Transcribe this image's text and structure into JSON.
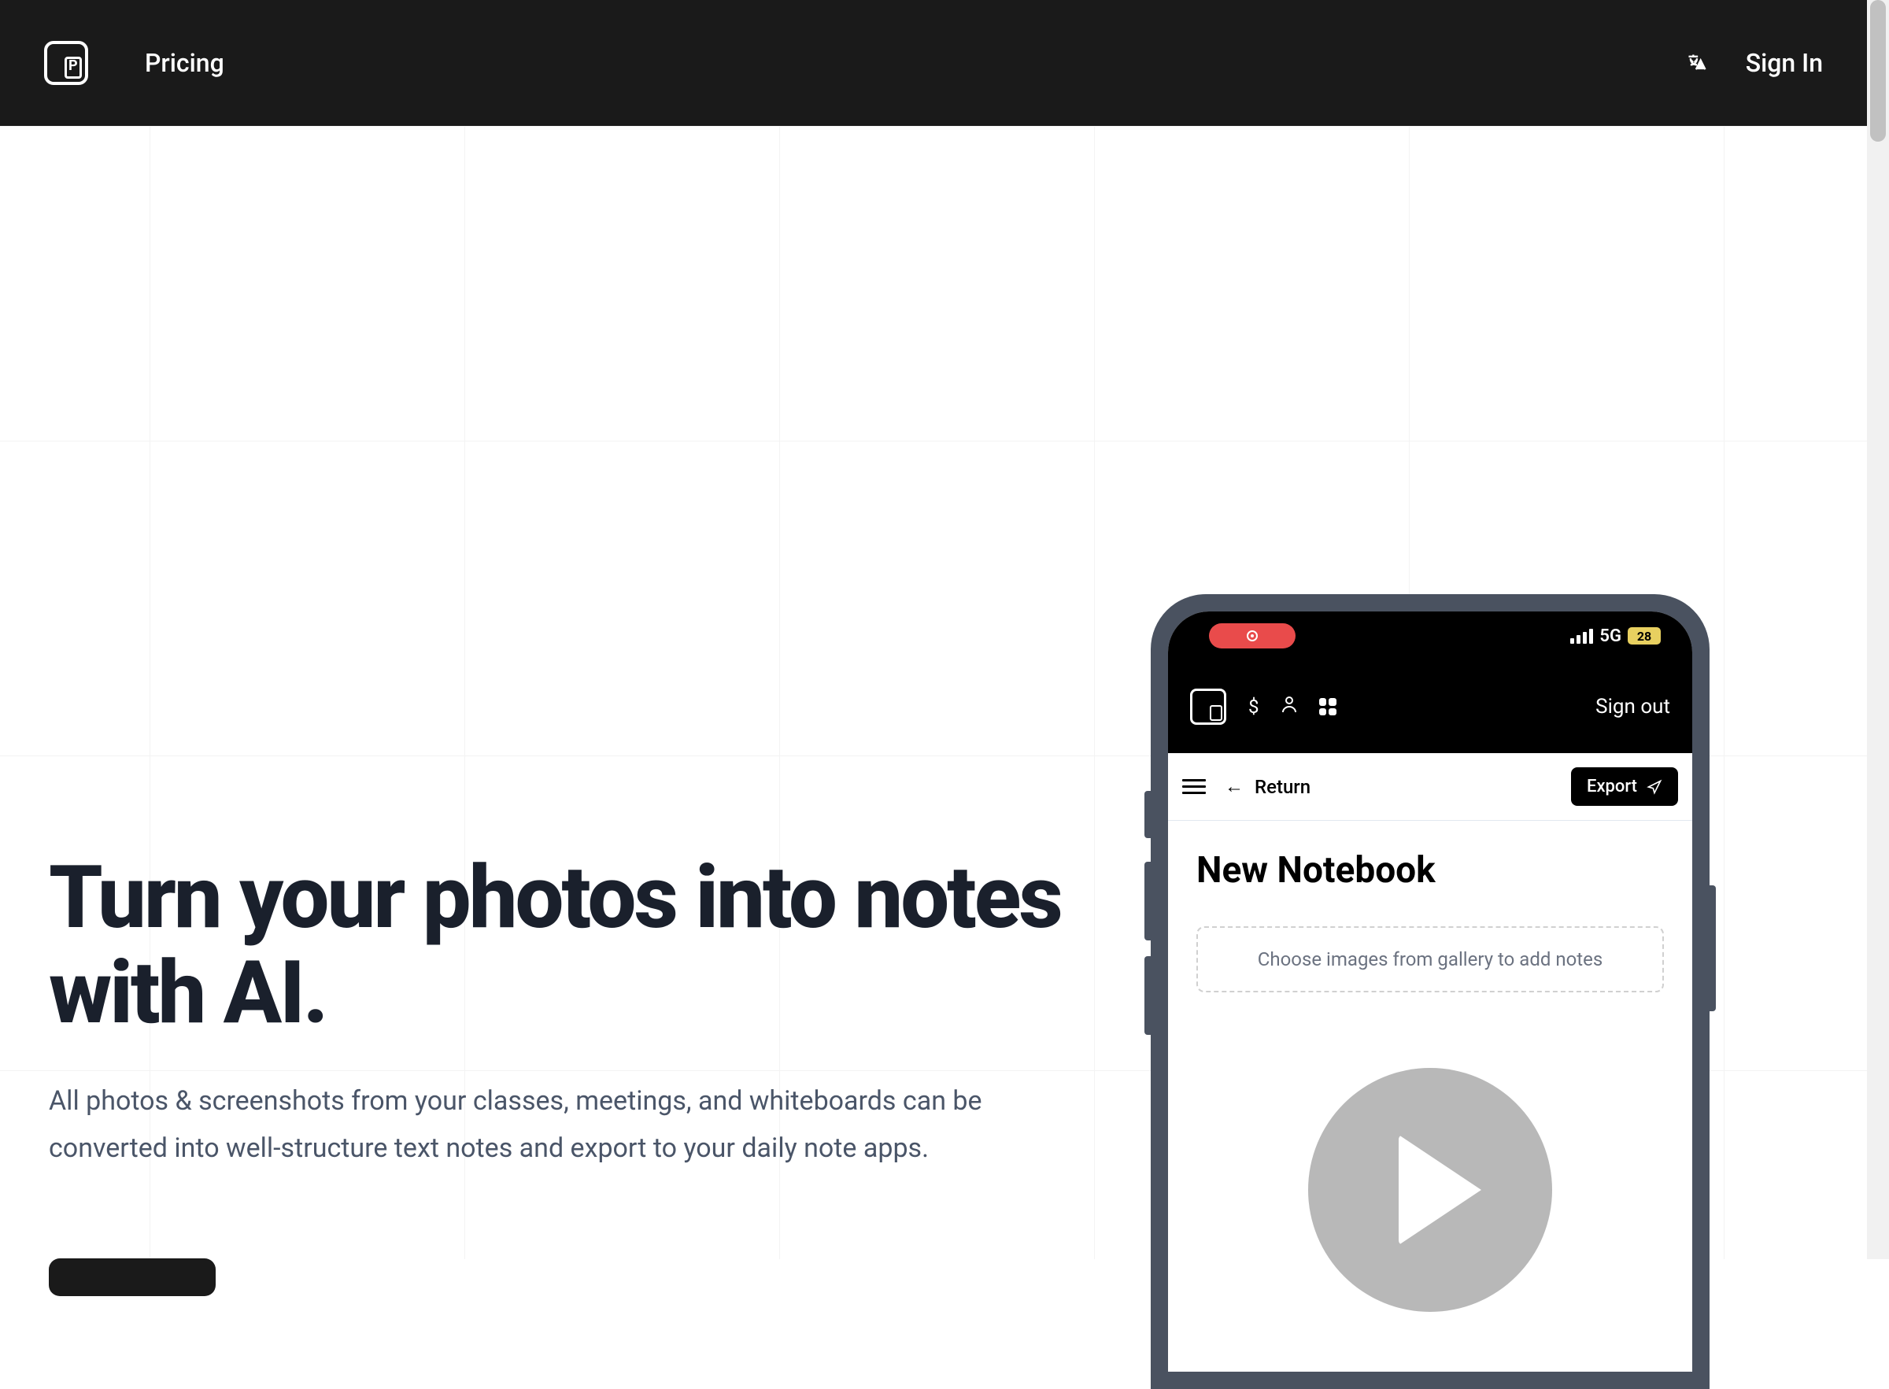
{
  "header": {
    "nav": {
      "pricing": "Pricing"
    },
    "signin": "Sign In"
  },
  "hero": {
    "title": "Turn your photos into notes with AI.",
    "subtitle": "All photos & screenshots from your classes, meetings, and whiteboards can be converted into well-structure text notes and export to your daily note apps."
  },
  "phone": {
    "status": {
      "network": "5G",
      "battery": "28"
    },
    "app": {
      "signout": "Sign out",
      "return": "Return",
      "export": "Export",
      "notebook_title": "New Notebook",
      "image_picker": "Choose images from gallery to add notes"
    }
  }
}
